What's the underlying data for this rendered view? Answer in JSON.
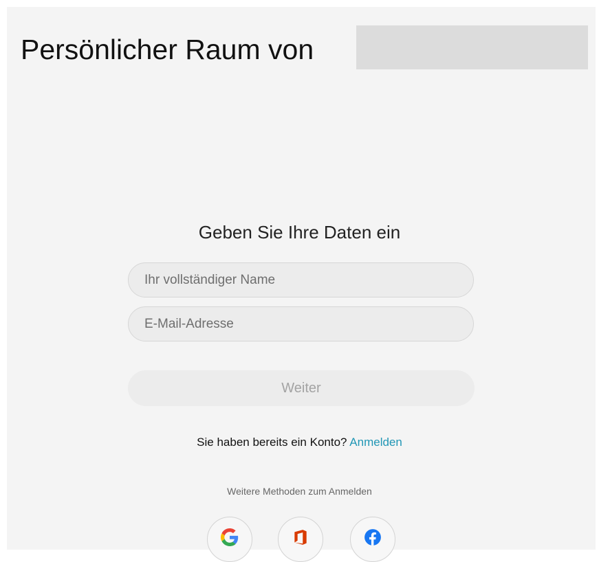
{
  "header": {
    "title": "Persönlicher Raum von"
  },
  "form": {
    "heading": "Geben Sie Ihre Daten ein",
    "name_placeholder": "Ihr vollständiger Name",
    "email_placeholder": "E-Mail-Adresse",
    "continue_label": "Weiter"
  },
  "account": {
    "prompt": "Sie haben bereits ein Konto?",
    "signin_link": "Anmelden"
  },
  "alternatives": {
    "label": "Weitere Methoden zum Anmelden",
    "providers": [
      {
        "icon": "google-icon"
      },
      {
        "icon": "office-icon"
      },
      {
        "icon": "facebook-icon"
      }
    ]
  },
  "colors": {
    "panel_background": "#f4f4f4",
    "link": "#2096b5",
    "button_disabled_text": "#a3a3a3",
    "google_blue": "#4285f4",
    "google_red": "#ea4335",
    "google_yellow": "#fbbc05",
    "google_green": "#34a853",
    "office_orange": "#d83b01",
    "facebook_blue": "#1877f2"
  }
}
